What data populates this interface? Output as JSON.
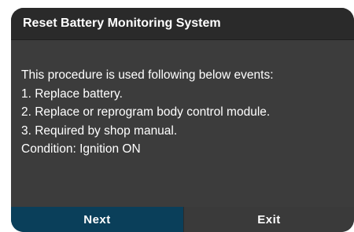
{
  "dialog": {
    "title": "Reset Battery Monitoring System",
    "lines": [
      "This procedure is used following below events:",
      "1. Replace battery.",
      "2. Replace or reprogram body control module.",
      "3. Required by shop manual.",
      "Condition: Ignition ON"
    ],
    "buttons": {
      "next_label": "Next",
      "exit_label": "Exit"
    }
  },
  "colors": {
    "dialog_background": "#3c3c3c",
    "title_bar": "#2a2a2a",
    "next_button": "#0a3f5a",
    "exit_button": "#3a3a3a",
    "text": "#ffffff"
  }
}
